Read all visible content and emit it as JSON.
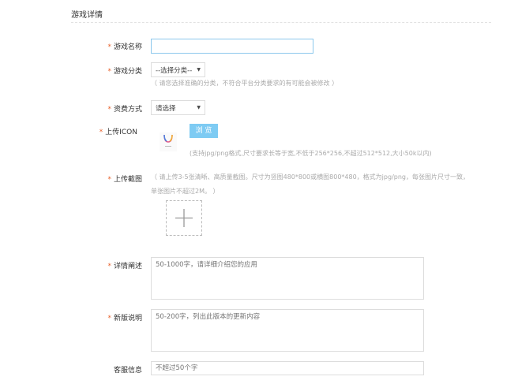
{
  "section_title": "游戏详情",
  "fields": {
    "name": {
      "label": "游戏名称",
      "required": true,
      "value": ""
    },
    "category": {
      "label": "游戏分类",
      "required": true,
      "selected": "--选择分类--",
      "hint": "（ 请您选择准确的分类，不符合平台分类要求的有可能会被修改 ）"
    },
    "pricing": {
      "label": "资费方式",
      "required": true,
      "selected": "请选择"
    },
    "icon": {
      "label": "上传ICON",
      "required": true,
      "browse_label": "浏 览",
      "hint": "(支持jpg/png格式,尺寸要求长等于宽,不低于256*256,不超过512*512,大小50k以内)"
    },
    "screenshots": {
      "label": "上传截图",
      "required": true,
      "hint_line1": "（ 请上传3-5张清晰、高质量截图。尺寸为竖图480*800或横图800*480，格式为jpg/png，每张图片尺寸一致，",
      "hint_line2": "单张图片不超过2M。 ）"
    },
    "description": {
      "label": "详情阐述",
      "required": true,
      "placeholder": "50-1000字，请详细介绍您的应用"
    },
    "release_notes": {
      "label": "新版说明",
      "required": true,
      "placeholder": "50-200字，列出此版本的更新内容"
    },
    "support": {
      "label": "客服信息",
      "required": false,
      "placeholder": "不超过50个字"
    }
  },
  "colors": {
    "accent": "#7ecbf3",
    "required_star": "#e8632e",
    "input_focus": "#7ecbf3"
  }
}
